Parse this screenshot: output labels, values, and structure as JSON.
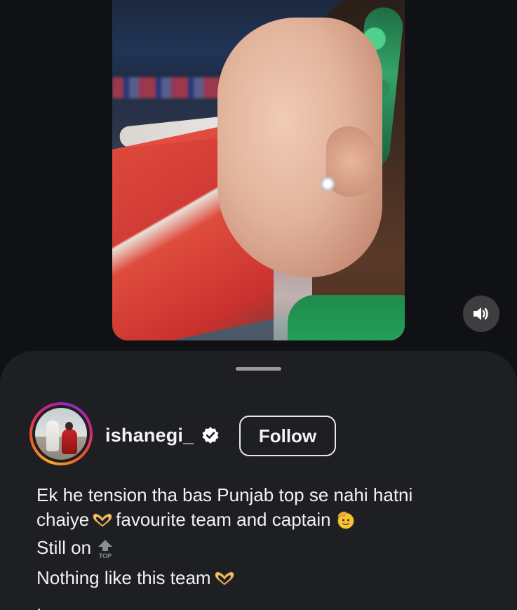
{
  "post": {
    "username": "ishanegi_",
    "follow_label": "Follow",
    "caption": {
      "line1": "Ek he tension tha bas Punjab top se nahi hatni",
      "line2_text": "chaiye",
      "line2_rest": "favourite team and captain",
      "line3": "Still on",
      "line4": "Nothing like this team",
      "line5": "."
    },
    "emoji": {
      "heart_hands": "heart-hands-icon",
      "saluting_face": "saluting-face-icon",
      "top_arrow": "top-arrow-icon",
      "top_text": "TOP"
    }
  },
  "colors": {
    "background": "#0f1114",
    "sheet": "#1d1f22",
    "text": "#f2f2f2",
    "verified": "#ffffff"
  }
}
